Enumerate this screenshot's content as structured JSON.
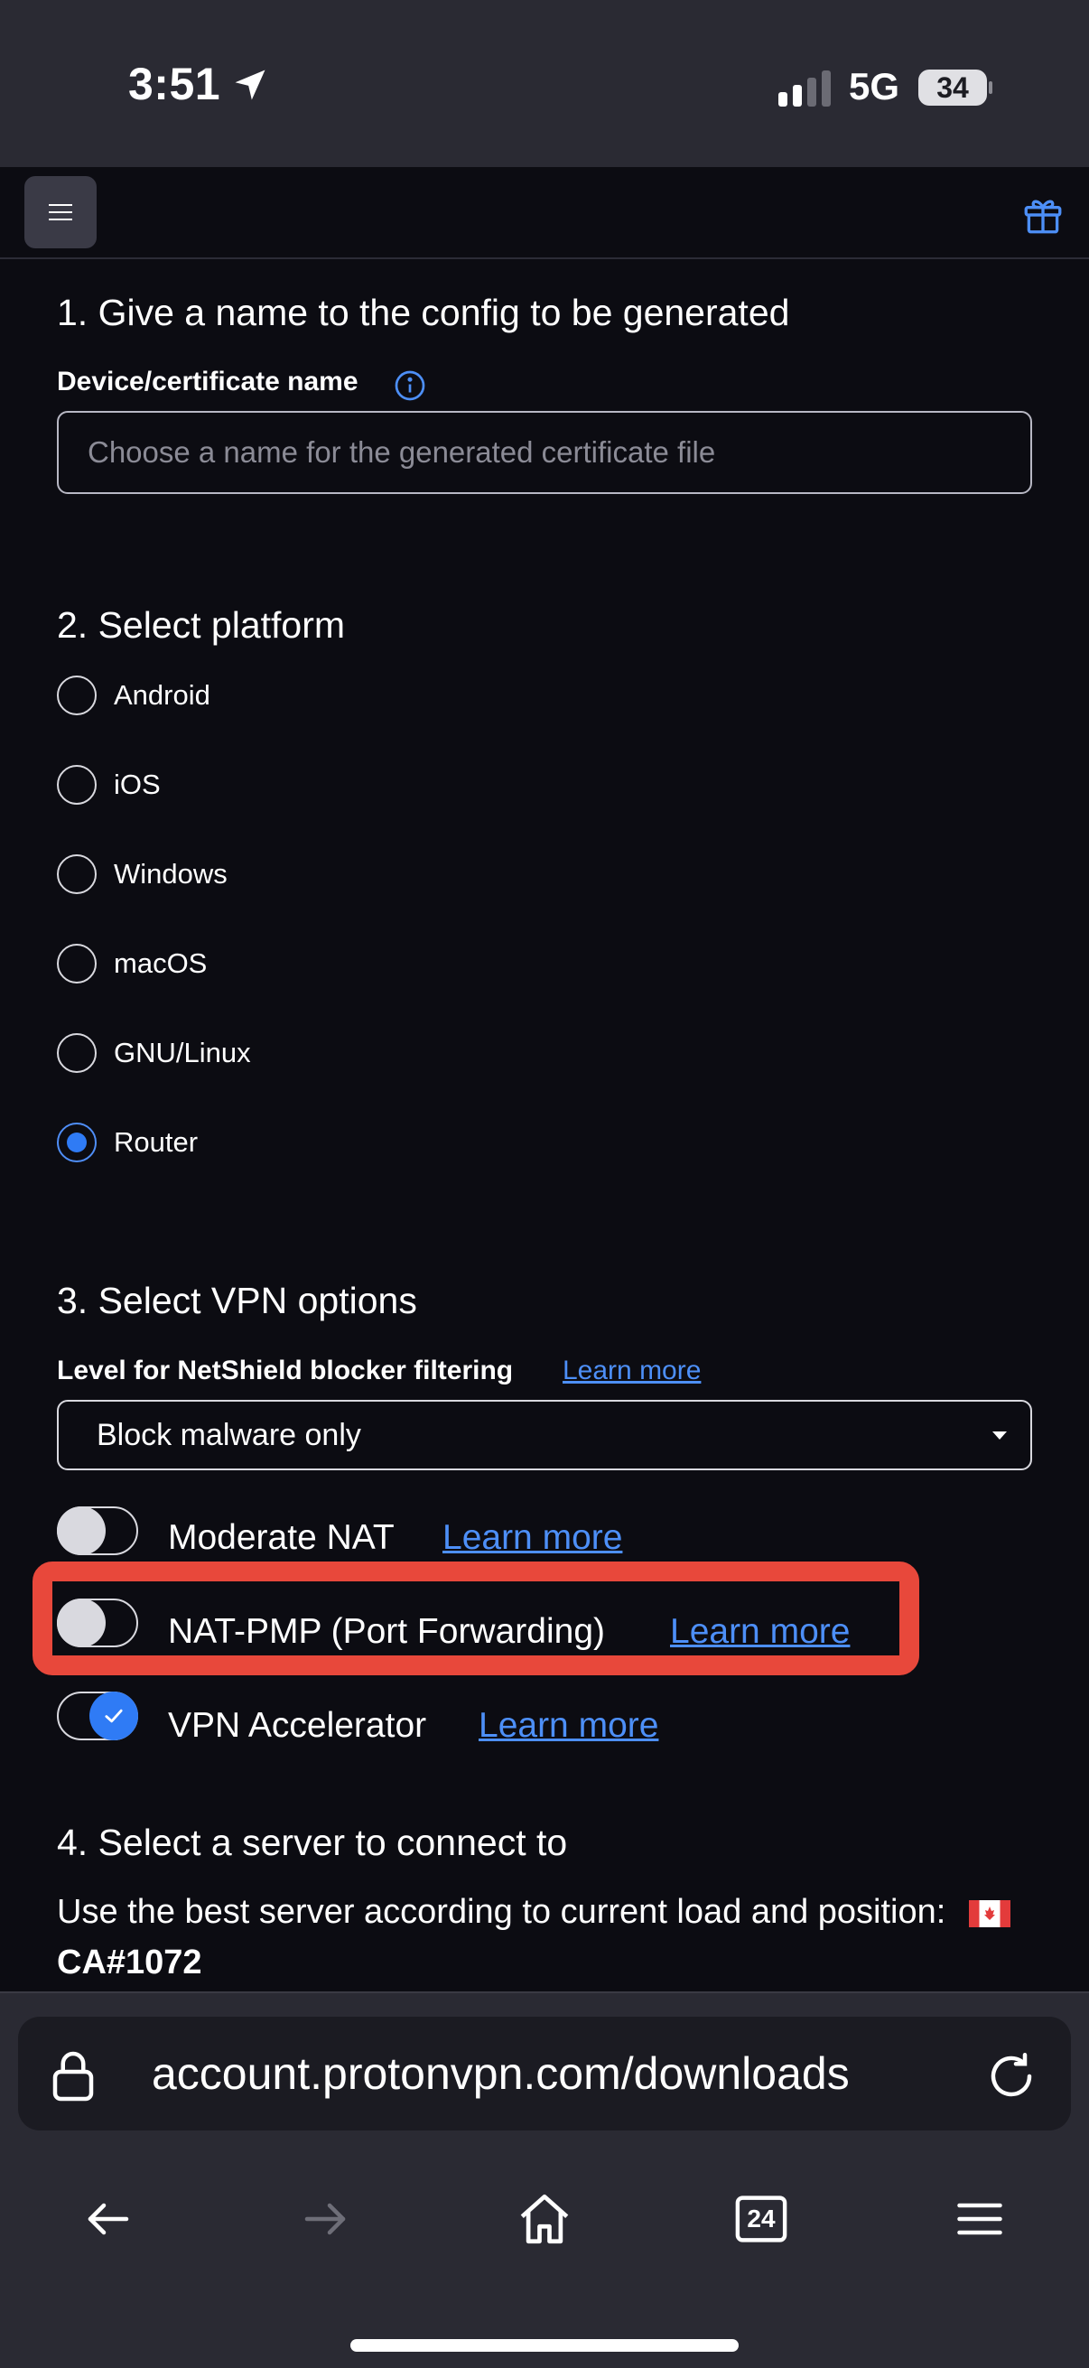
{
  "status_bar": {
    "time": "3:51",
    "network": "5G",
    "battery": "34"
  },
  "sections": {
    "config_name": {
      "title": "1. Give a name to the config to be generated",
      "label": "Device/certificate name",
      "placeholder": "Choose a name for the generated certificate file",
      "value": ""
    },
    "platform": {
      "title": "2. Select platform",
      "options": [
        "Android",
        "iOS",
        "Windows",
        "macOS",
        "GNU/Linux",
        "Router"
      ],
      "selected": "Router"
    },
    "vpn_options": {
      "title": "3. Select VPN options",
      "netshield_label": "Level for NetShield blocker filtering",
      "netshield_link": "Learn more",
      "netshield_selected": "Block malware only",
      "toggles": [
        {
          "label": "Moderate NAT",
          "link": "Learn more",
          "on": false
        },
        {
          "label": "NAT-PMP (Port Forwarding)",
          "link": "Learn more",
          "on": false
        },
        {
          "label": "VPN Accelerator",
          "link": "Learn more",
          "on": true
        }
      ]
    },
    "server": {
      "title": "4. Select a server to connect to",
      "description": "Use the best server according to current load and position:",
      "server_code": "CA#1072"
    }
  },
  "browser": {
    "url": "account.protonvpn.com/downloads",
    "tab_count": "24"
  },
  "colors": {
    "accent": "#4d8ff7",
    "highlight": "#e8483b",
    "background": "#0c0c12"
  }
}
